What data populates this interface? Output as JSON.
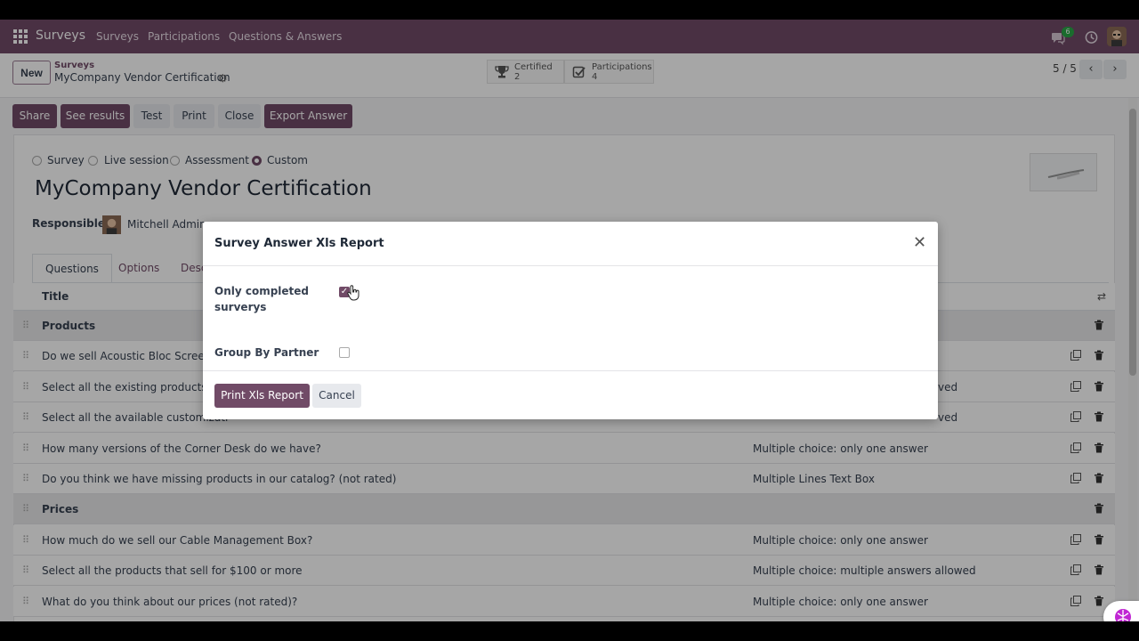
{
  "navbar": {
    "brand": "Surveys",
    "menu": [
      "Surveys",
      "Participations",
      "Questions & Answers"
    ],
    "chat_badge": "6",
    "bg_color": "#714b67"
  },
  "control_panel": {
    "new_label": "New",
    "breadcrumb_parent": "Surveys",
    "breadcrumb_current": "MyCompany Vendor Certification",
    "stats": [
      {
        "label": "Certified",
        "value": "2",
        "icon": "trophy-icon"
      },
      {
        "label": "Participations",
        "value": "4",
        "icon": "checkbox-icon"
      }
    ],
    "pager": "5 / 5"
  },
  "actions": [
    "Share",
    "See results",
    "Test",
    "Print",
    "Close",
    "Export Answer"
  ],
  "form": {
    "survey_types": [
      "Survey",
      "Live session",
      "Assessment",
      "Custom"
    ],
    "selected_type": "Custom",
    "title": "MyCompany Vendor Certification",
    "responsible_label": "Responsible",
    "responsible_name": "Mitchell Admin",
    "tabs": [
      "Questions",
      "Options",
      "Desc"
    ]
  },
  "table": {
    "header_title": "Title",
    "rows": [
      {
        "title": "Products",
        "type": "",
        "section": true
      },
      {
        "title": "Do we sell Acoustic Bloc Screens?",
        "type": "",
        "section": false
      },
      {
        "title": "Select all the existing products",
        "type": "ved",
        "section": false
      },
      {
        "title": "Select all the available customizati",
        "type": "ved",
        "section": false
      },
      {
        "title": "How many versions of the Corner Desk do we have?",
        "type": "Multiple choice: only one answer",
        "section": false
      },
      {
        "title": "Do you think we have missing products in our catalog? (not rated)",
        "type": "Multiple Lines Text Box",
        "section": false
      },
      {
        "title": "Prices",
        "type": "",
        "section": true
      },
      {
        "title": "How much do we sell our Cable Management Box?",
        "type": "Multiple choice: only one answer",
        "section": false
      },
      {
        "title": "Select all the products that sell for $100 or more",
        "type": "Multiple choice: multiple answers allowed",
        "section": false
      },
      {
        "title": "What do you think about our prices (not rated)?",
        "type": "Multiple choice: only one answer",
        "section": false
      }
    ]
  },
  "modal": {
    "title": "Survey Answer Xls Report",
    "field1_label_line1": "Only completed",
    "field1_label_line2": "surverys",
    "field1_checked": true,
    "field2_label": "Group By Partner",
    "field2_checked": false,
    "print_label": "Print Xls Report",
    "cancel_label": "Cancel"
  }
}
